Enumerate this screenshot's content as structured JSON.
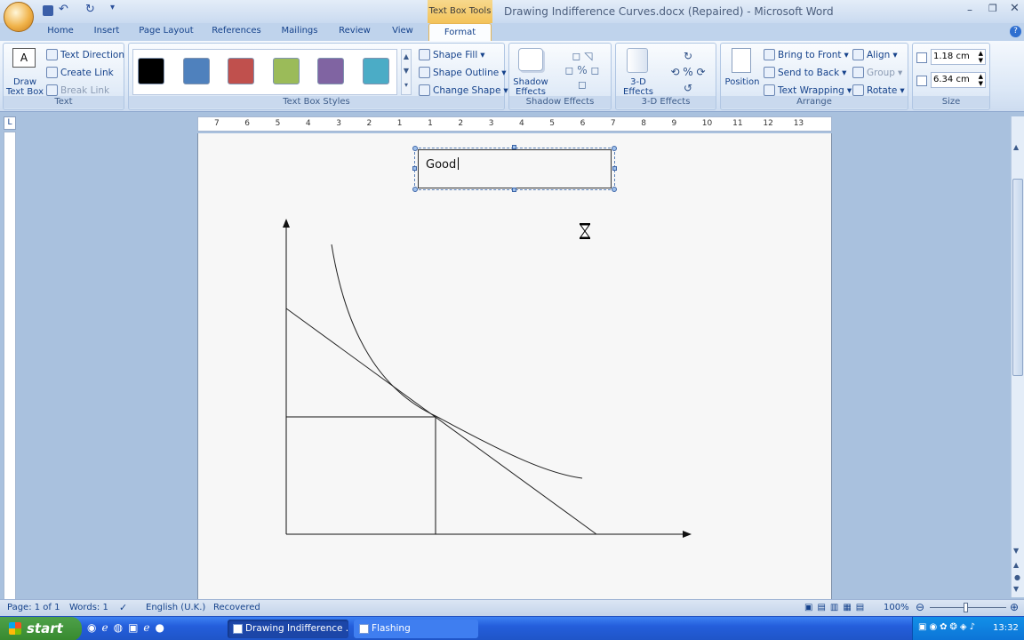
{
  "window": {
    "title": "Drawing Indifference Curves.docx (Repaired) - Microsoft Word",
    "contextual_tab_group": "Text Box Tools"
  },
  "tabs": [
    "Home",
    "Insert",
    "Page Layout",
    "References",
    "Mailings",
    "Review",
    "View",
    "Format"
  ],
  "active_tab": "Format",
  "ribbon": {
    "text_group": {
      "label": "Text",
      "draw_text_box": "Draw\nText Box",
      "text_direction": "Text Direction",
      "create_link": "Create Link",
      "break_link": "Break Link"
    },
    "styles_group": {
      "label": "Text Box Styles",
      "swatches": [
        "#000000",
        "#4f81bd",
        "#c0504d",
        "#9bbb59",
        "#8064a2",
        "#4bacc6"
      ],
      "shape_fill": "Shape Fill",
      "shape_outline": "Shape Outline",
      "change_shape": "Change Shape"
    },
    "shadow_group": {
      "label": "Shadow Effects",
      "button": "Shadow\nEffects"
    },
    "threed_group": {
      "label": "3-D Effects",
      "button": "3-D\nEffects"
    },
    "arrange_group": {
      "label": "Arrange",
      "position": "Position",
      "bring_to_front": "Bring to Front",
      "send_to_back": "Send to Back",
      "text_wrapping": "Text Wrapping",
      "align": "Align",
      "group": "Group",
      "rotate": "Rotate"
    },
    "size_group": {
      "label": "Size",
      "height": "1.18 cm",
      "width": "6.34 cm"
    }
  },
  "ruler": {
    "labels": [
      "7",
      "6",
      "5",
      "4",
      "3",
      "2",
      "1",
      "1",
      "2",
      "3",
      "4",
      "5",
      "6",
      "7",
      "8",
      "9",
      "10",
      "11",
      "12",
      "13"
    ]
  },
  "document": {
    "text_box_content": "Good"
  },
  "status_bar": {
    "page": "Page: 1 of 1",
    "words": "Words: 1",
    "language": "English (U.K.)",
    "recovered": "Recovered",
    "zoom": "100%"
  },
  "taskbar": {
    "start": "start",
    "tasks": [
      "Drawing Indifference ...",
      "Flashing"
    ],
    "clock": "13:32"
  }
}
